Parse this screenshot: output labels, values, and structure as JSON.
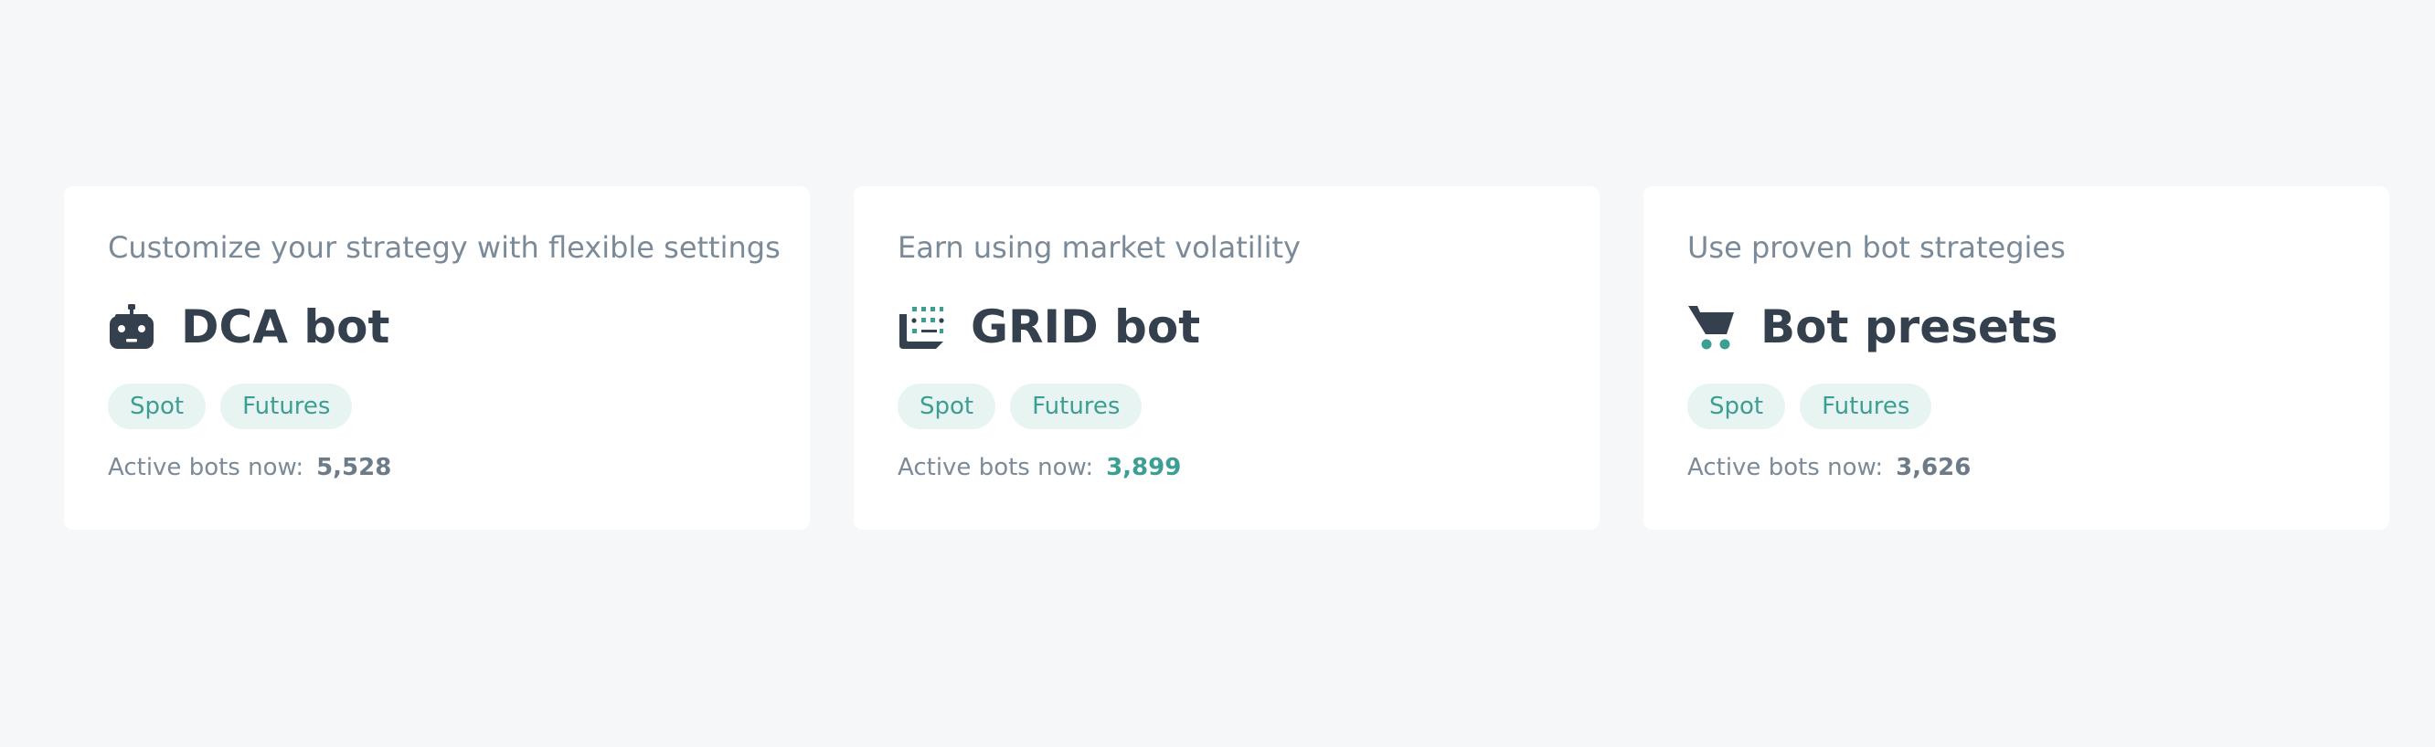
{
  "colors": {
    "accent": "#3d9e93",
    "title": "#35404f",
    "muted": "#7b8a99",
    "tag_bg": "#e8f4f2",
    "page_bg": "#f6f7f9"
  },
  "cards": [
    {
      "subtitle": "Customize your strategy with flexible settings",
      "title": "DCA bot",
      "icon": "robot-icon",
      "tags": [
        "Spot",
        "Futures"
      ],
      "stats_label": "Active bots now:",
      "stats_value": "5,528"
    },
    {
      "subtitle": "Earn using market volatility",
      "title": "GRID bot",
      "icon": "grid-icon",
      "tags": [
        "Spot",
        "Futures"
      ],
      "stats_label": "Active bots now:",
      "stats_value": "3,899"
    },
    {
      "subtitle": "Use proven bot strategies",
      "title": "Bot presets",
      "icon": "cart-icon",
      "tags": [
        "Spot",
        "Futures"
      ],
      "stats_label": "Active bots now:",
      "stats_value": "3,626"
    }
  ]
}
